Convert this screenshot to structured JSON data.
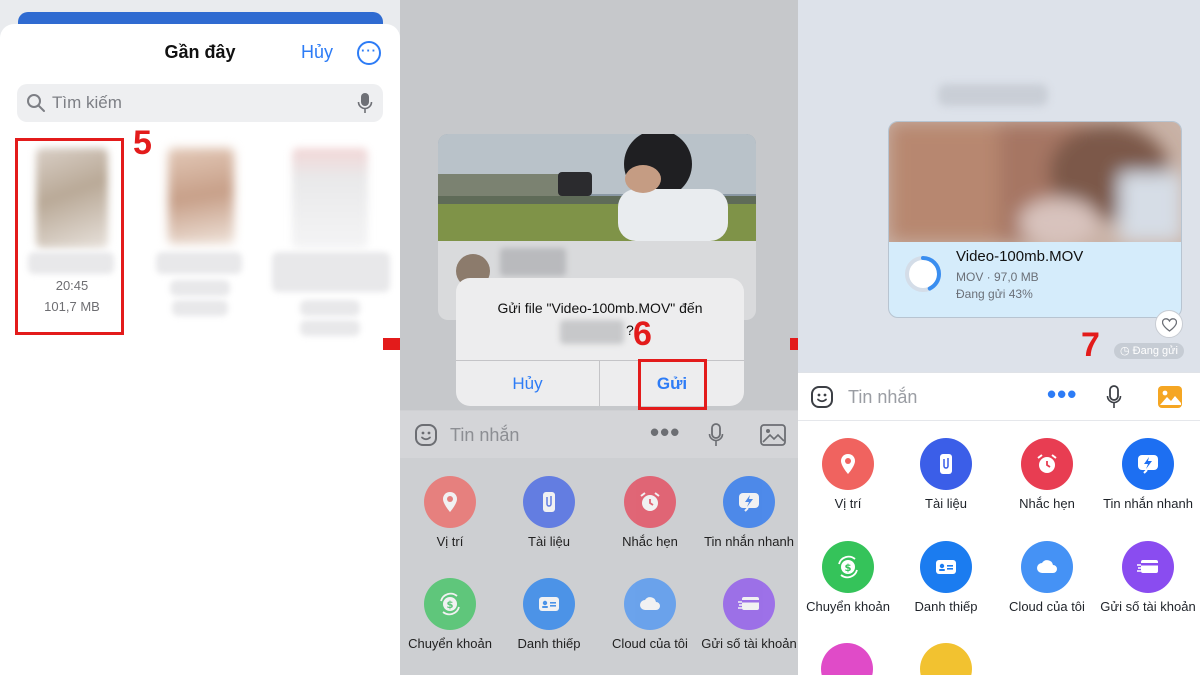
{
  "panel1": {
    "title": "Gần đây",
    "cancel": "Hủy",
    "search_placeholder": "Tìm kiếm",
    "file_time": "20:45",
    "file_size": "101,7 MB",
    "step": "5"
  },
  "panel2": {
    "dialog_message": "Gửi file \"Video-100mb.MOV\" đến",
    "dialog_question": "?",
    "cancel": "Hủy",
    "send": "Gửi",
    "step": "6",
    "composer_placeholder": "Tin nhắn",
    "tools": [
      {
        "label": "Vị trí",
        "icon": "location-pin-icon",
        "color": "#f0635f"
      },
      {
        "label": "Tài liệu",
        "icon": "paperclip-document-icon",
        "color": "#3b5ee8"
      },
      {
        "label": "Nhắc hẹn",
        "icon": "alarm-clock-icon",
        "color": "#e83d52"
      },
      {
        "label": "Tin nhắn nhanh",
        "icon": "lightning-message-icon",
        "color": "#1d6ff2"
      },
      {
        "label": "Chuyển khoản",
        "icon": "money-transfer-icon",
        "color": "#35c35a"
      },
      {
        "label": "Danh thiếp",
        "icon": "contact-card-icon",
        "color": "#1b7cf0"
      },
      {
        "label": "Cloud của tôi",
        "icon": "cloud-icon",
        "color": "#4592f5"
      },
      {
        "label": "Gửi số tài khoản",
        "icon": "bank-card-icon",
        "color": "#8a4cf0"
      }
    ]
  },
  "panel3": {
    "file_name": "Video-100mb.MOV",
    "file_meta": "MOV · 97,0 MB",
    "file_status": "Đang gửi 43%",
    "upload_progress": 0.43,
    "message_status": "Đang gửi",
    "step": "7",
    "composer_placeholder": "Tin nhắn"
  },
  "colors": {
    "accent": "#2d7cf6",
    "highlight": "#e31b1b"
  }
}
